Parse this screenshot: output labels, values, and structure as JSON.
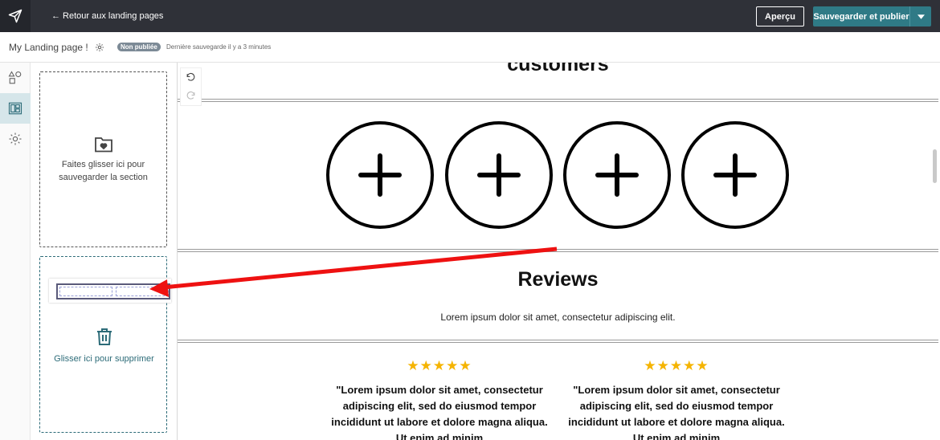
{
  "topbar": {
    "back_label": "← Retour aux landing pages",
    "preview_label": "Aperçu",
    "save_label": "Sauvegarder et publier"
  },
  "subbar": {
    "page_name": "My Landing page !",
    "status": "Non publiée",
    "last_save": "Dernière sauvegarde il y a 3 minutes"
  },
  "panel": {
    "save_zone_text": "Faites glisser ici pour sauvegarder la section",
    "delete_zone_text": "Glisser ici pour supprimer"
  },
  "canvas": {
    "heading": "customers",
    "reviews_title": "Reviews",
    "reviews_subtitle": "Lorem ipsum dolor sit amet, consectetur adipiscing elit.",
    "reviews": [
      {
        "stars": "★★★★★",
        "quote": "\"Lorem ipsum dolor sit amet, consectetur adipiscing elit, sed do eiusmod tempor incididunt ut labore et dolore magna aliqua. Ut enim ad minim"
      },
      {
        "stars": "★★★★★",
        "quote": "\"Lorem ipsum dolor sit amet, consectetur adipiscing elit, sed do eiusmod tempor incididunt ut labore et dolore magna aliqua. Ut enim ad minim"
      }
    ]
  },
  "colors": {
    "topbar": "#2f3138",
    "accent": "#2f7a86",
    "star": "#f5b400",
    "annotation_arrow": "#ee1111"
  },
  "icons": [
    "send-icon",
    "settings-icon",
    "shapes-icon",
    "layout-icon",
    "folder-heart-icon",
    "trash-icon",
    "undo-icon",
    "redo-icon",
    "plus-circle-icon",
    "chevron-down-icon"
  ]
}
